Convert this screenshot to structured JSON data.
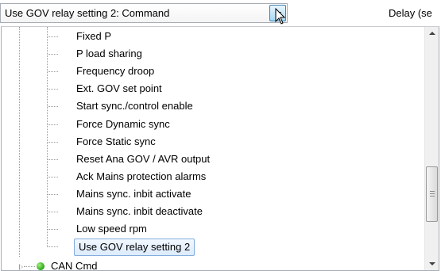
{
  "combo": {
    "value": "Use GOV relay setting 2: Command",
    "dropdown_icon": "chevron-down-icon"
  },
  "delay_label": "Delay (se",
  "tree": {
    "items": [
      {
        "label": "Fixed P"
      },
      {
        "label": "P load sharing"
      },
      {
        "label": "Frequency droop"
      },
      {
        "label": "Ext. GOV set point"
      },
      {
        "label": "Start sync./control enable"
      },
      {
        "label": "Force Dynamic sync"
      },
      {
        "label": "Force Static sync"
      },
      {
        "label": "Reset Ana GOV / AVR output"
      },
      {
        "label": "Ack Mains protection alarms"
      },
      {
        "label": "Mains sync. inbit activate"
      },
      {
        "label": "Mains sync. inbit deactivate"
      },
      {
        "label": "Low speed rpm"
      },
      {
        "label": "Use GOV relay setting 2",
        "selected": true
      }
    ],
    "collapsed_node": {
      "label": "CAN Cmd",
      "icon": "green-status-dot-icon",
      "status_color": "#2aa31a"
    }
  },
  "colors": {
    "selection_border": "#84acdd",
    "selection_fill": "#dcebfc",
    "combo_button": "#a7d9f5"
  }
}
